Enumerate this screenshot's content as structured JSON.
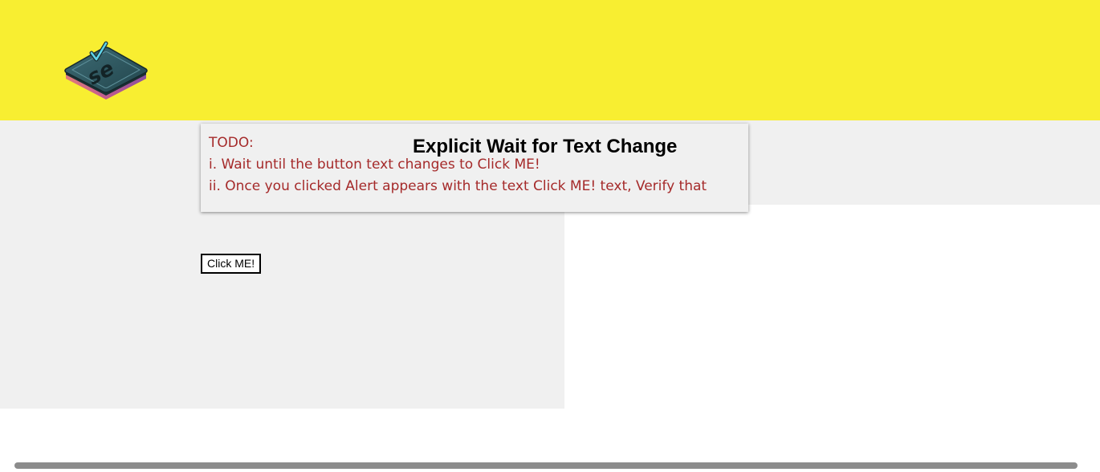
{
  "header": {
    "background_color": "#f8ee31",
    "logo": {
      "icon": "selenium-logo-icon",
      "text": "se"
    }
  },
  "task": {
    "todo_label": "TODO:",
    "title": "Explicit Wait for Text Change",
    "steps": [
      "i. Wait until the button text changes to Click ME!",
      "ii. Once you clicked Alert appears with the text Click ME! text, Verify that"
    ],
    "text_color": "#a52a2a"
  },
  "button": {
    "label": "Click ME!"
  }
}
